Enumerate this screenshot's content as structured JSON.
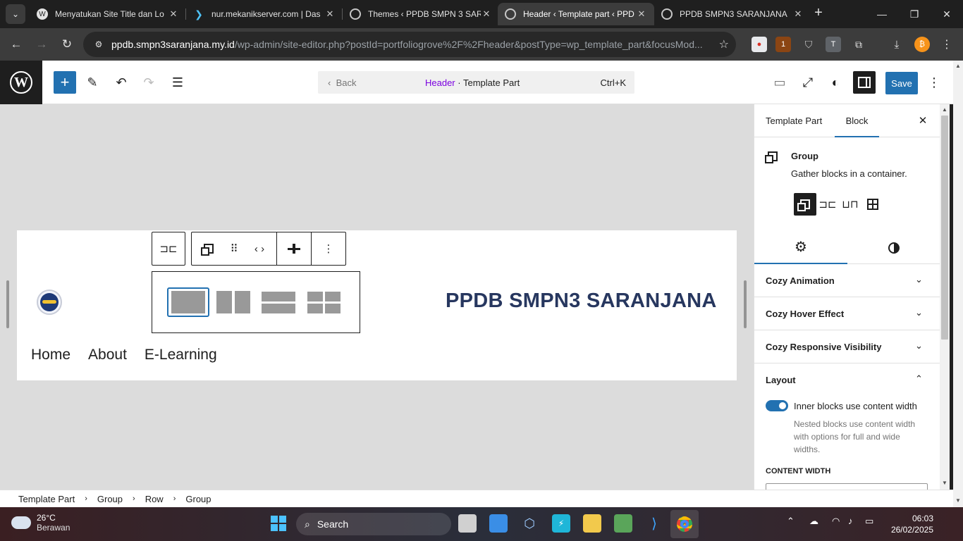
{
  "browser": {
    "tabs": [
      {
        "title": "Menyatukan Site Title dan Lo",
        "active": false
      },
      {
        "title": "nur.mekanikserver.com | Das",
        "active": false
      },
      {
        "title": "Themes ‹ PPDB SMPN 3 SAR",
        "active": false
      },
      {
        "title": "Header ‹ Template part ‹ PPD",
        "active": true
      },
      {
        "title": "PPDB SMPN3 SARANJANA",
        "active": false
      }
    ],
    "url_host": "ppdb.smpn3saranjana.my.id",
    "url_path": "/wp-admin/site-editor.php?postId=portfoliogrove%2F%2Fheader&postType=wp_template_part&focusMod...",
    "extension_badge": "1"
  },
  "editor": {
    "command": {
      "back": "Back",
      "doc_name": "Header",
      "doc_type": "· Template Part",
      "shortcut": "Ctrl+K"
    },
    "save_label": "Save"
  },
  "site": {
    "title": "PPDB SMPN3 SARANJANA",
    "menu": [
      "Home",
      "About",
      "E-Learning"
    ]
  },
  "breadcrumb": [
    "Template Part",
    "Group",
    "Row",
    "Group"
  ],
  "sidebar": {
    "tabs": [
      "Template Part",
      "Block"
    ],
    "active_tab": "Block",
    "block_name": "Group",
    "block_desc": "Gather blocks in a container.",
    "panels": [
      {
        "label": "Cozy Animation",
        "open": false
      },
      {
        "label": "Cozy Hover Effect",
        "open": false
      },
      {
        "label": "Cozy Responsive Visibility",
        "open": false
      },
      {
        "label": "Layout",
        "open": true
      }
    ],
    "layout": {
      "toggle_label": "Inner blocks use content width",
      "toggle_on": true,
      "help": "Nested blocks use content width with options for full and wide widths.",
      "content_width_label": "CONTENT WIDTH"
    }
  },
  "taskbar": {
    "temp": "26°C",
    "weather": "Berawan",
    "search": "Search",
    "time": "06:03",
    "date": "26/02/2025"
  },
  "colors": {
    "wp_blue": "#2271b1",
    "site_title": "#27375f",
    "doc_name": "#7a00df"
  }
}
